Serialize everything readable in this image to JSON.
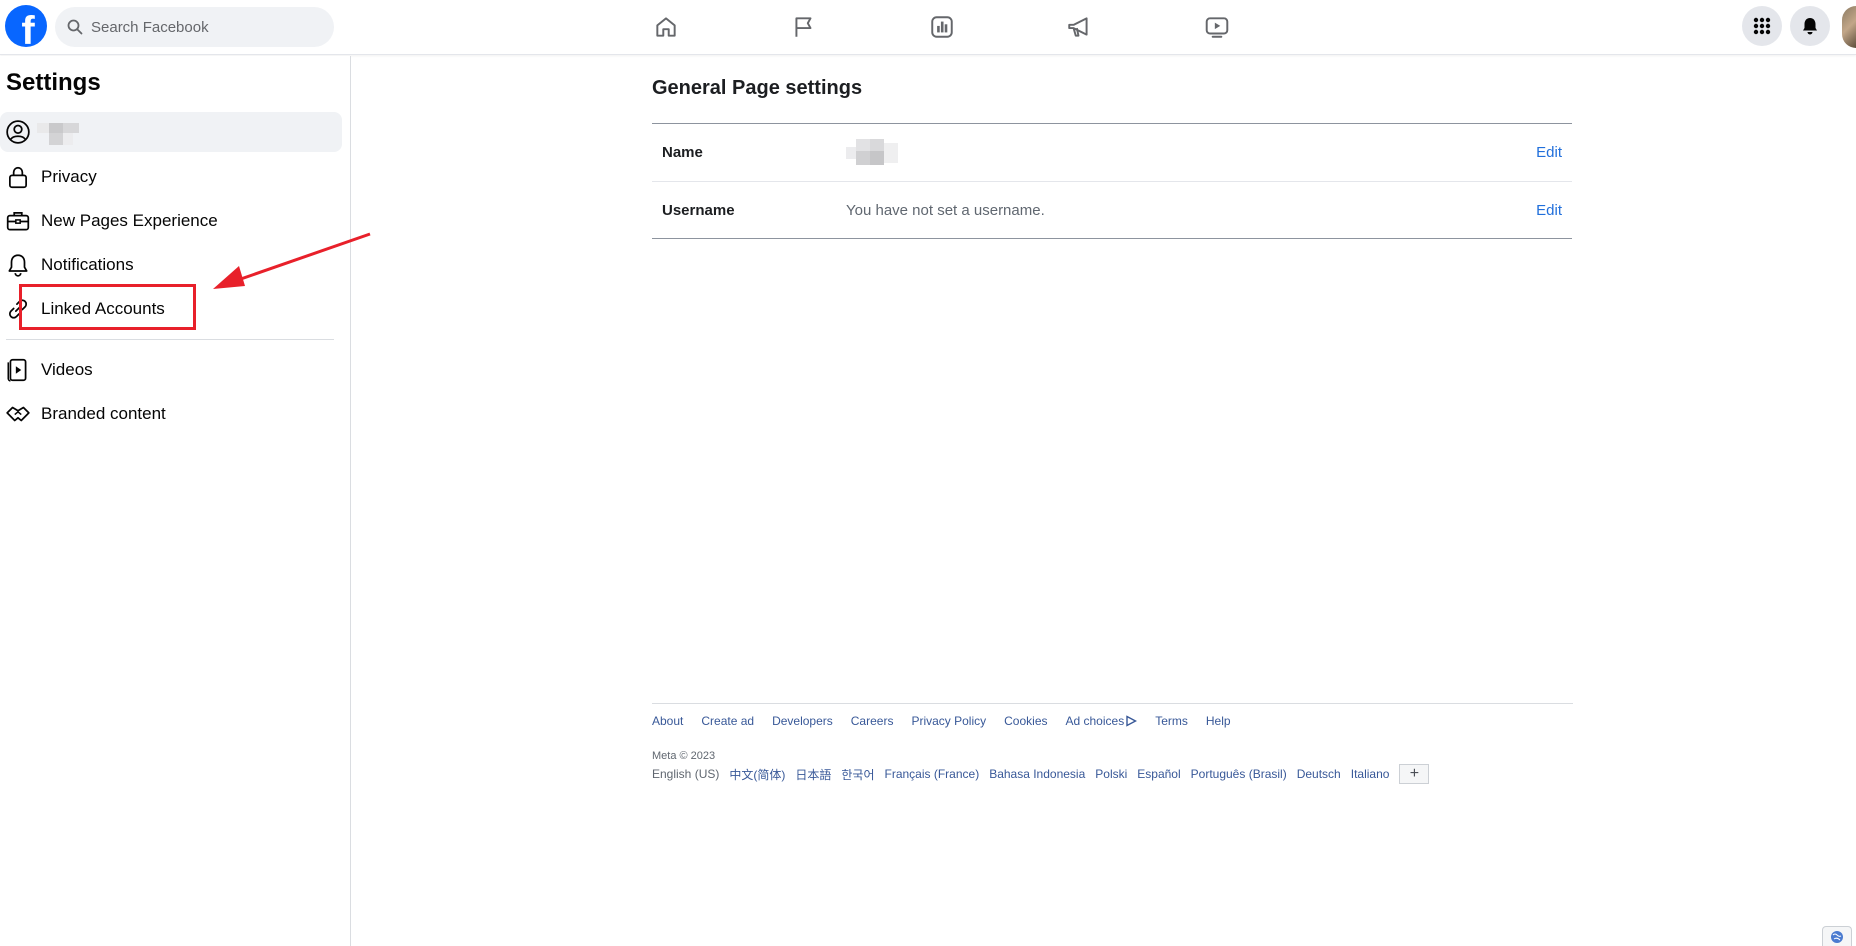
{
  "search": {
    "placeholder": "Search Facebook"
  },
  "nav": {
    "icons": [
      "home-icon",
      "flag-icon",
      "insights-icon",
      "megaphone-icon",
      "video-icon"
    ]
  },
  "sidebar": {
    "title": "Settings",
    "items": [
      {
        "label": "",
        "icon": "profile-icon"
      },
      {
        "label": "Privacy",
        "icon": "lock-icon"
      },
      {
        "label": "New Pages Experience",
        "icon": "briefcase-icon"
      },
      {
        "label": "Notifications",
        "icon": "bell-icon"
      },
      {
        "label": "Linked Accounts",
        "icon": "link-icon"
      },
      {
        "label": "Videos",
        "icon": "video-file-icon"
      },
      {
        "label": "Branded content",
        "icon": "handshake-icon"
      }
    ]
  },
  "main": {
    "title": "General Page settings",
    "rows": [
      {
        "key": "Name",
        "value": "",
        "action": "Edit"
      },
      {
        "key": "Username",
        "value": "You have not set a username.",
        "action": "Edit"
      }
    ]
  },
  "footer": {
    "links": [
      "About",
      "Create ad",
      "Developers",
      "Careers",
      "Privacy Policy",
      "Cookies",
      "Ad choices",
      "Terms",
      "Help"
    ],
    "copyright": "Meta © 2023",
    "current_language": "English (US)",
    "languages": [
      "中文(简体)",
      "日本語",
      "한국어",
      "Français (France)",
      "Bahasa Indonesia",
      "Polski",
      "Español",
      "Português (Brasil)",
      "Deutsch",
      "Italiano"
    ],
    "more": "+"
  },
  "colors": {
    "accent": "#0866ff",
    "link": "#385898",
    "highlight": "#e8202a"
  }
}
